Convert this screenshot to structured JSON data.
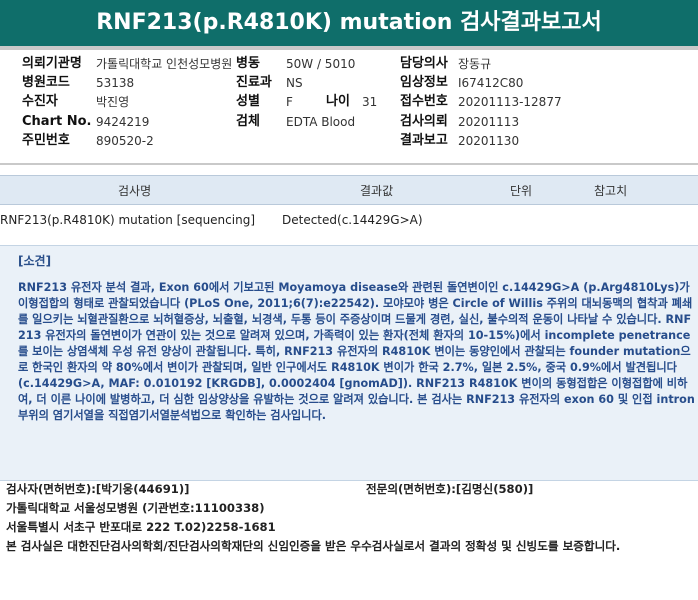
{
  "report_title": "RNF213(p.R4810K) mutation 검사결과보고서",
  "patient_info": {
    "institution_label": "의뢰기관명",
    "institution_value": "가톨릭대학교 인천성모병원",
    "ward_label": "병동",
    "ward_value": "50W / 5010",
    "doctor_label": "담당의사",
    "doctor_value": "장동규",
    "hospital_code_label": "병원코드",
    "hospital_code_value": "53138",
    "dept_label": "진료과",
    "dept_value": "NS",
    "clinical_label": "임상정보",
    "clinical_value": "I67412C80",
    "examinee_label": "수진자",
    "examinee_value": "박진영",
    "sex_label": "성별",
    "sex_value": "F",
    "age_label": "나이",
    "age_value": "31",
    "receipt_label": "접수번호",
    "receipt_value": "20201113-12877",
    "chart_label": "Chart No.",
    "chart_value": "9424219",
    "specimen_label": "검체",
    "specimen_value": "EDTA Blood",
    "request_label": "검사의뢰",
    "request_value": "20201113",
    "id_label": "주민번호",
    "id_value": "890520-2",
    "report_label": "결과보고",
    "report_value": "20201130"
  },
  "results_table": {
    "headers": {
      "test": "검사명",
      "result": "결과값",
      "unit": "단위",
      "reference": "참고치"
    },
    "row": {
      "test": "RNF213(p.R4810K) mutation [sequencing]",
      "result": "Detected(c.14429G>A)",
      "unit": "",
      "reference": ""
    }
  },
  "comment": {
    "heading": "[소견]",
    "body": "RNF213 유전자 분석 결과, Exon 60에서 기보고된 Moyamoya disease와 관련된 돌연변이인 c.14429G>A (p.Arg4810Lys)가 이형접합의 형태로 관찰되었습니다 (PLoS One, 2011;6(7):e22542). 모야모야 병은 Circle of Willis 주위의 대뇌동맥의 협착과 폐쇄를 일으키는 뇌혈관질환으로 뇌허혈증상, 뇌출혈, 뇌경색, 두통 등이 주증상이며 드물게 경련, 실신, 불수의적 운동이 나타날 수 있습니다. RNF213 유전자의 돌연변이가 연관이 있는 것으로 알려져 있으며, 가족력이 있는 환자(전체 환자의 10-15%)에서 incomplete penetrance를 보이는 상염색체 우성 유전 양상이 관찰됩니다. 특히, RNF213 유전자의 R4810K 변이는 동양인에서 관찰되는 founder mutation으로 한국인 환자의 약 80%에서 변이가 관찰되며, 일반 인구에서도 R4810K 변이가 한국 2.7%, 일본 2.5%, 중국 0.9%에서 발견됩니다 (c.14429G>A, MAF: 0.010192 [KRGDB], 0.0002404 [gnomAD]). RNF213 R4810K 변이의 동형접합은 이형접합에 비하여, 더 이른 나이에 발병하고, 더 심한 임상양상을 유발하는 것으로 알려져 있습니다. 본 검사는 RNF213 유전자의 exon 60 및 인접 intron 부위의 염기서열을 직접염기서열분석법으로 확인하는 검사입니다."
  },
  "footer": {
    "examiner": "검사자(면허번호):[박기웅(44691)]",
    "specialist": "전문의(면허번호):[김명신(580)]",
    "hospital": "가톨릭대학교 서울성모병원 (기관번호:11100338)",
    "address": "서울특별시 서초구 반포대로 222 T.02)2258-1681",
    "certification": "본 검사실은 대한진단검사의학회/진단검사의학재단의 신임인증을 받은 우수검사실로서 결과의 정확성 및 신빙도를 보증합니다."
  }
}
